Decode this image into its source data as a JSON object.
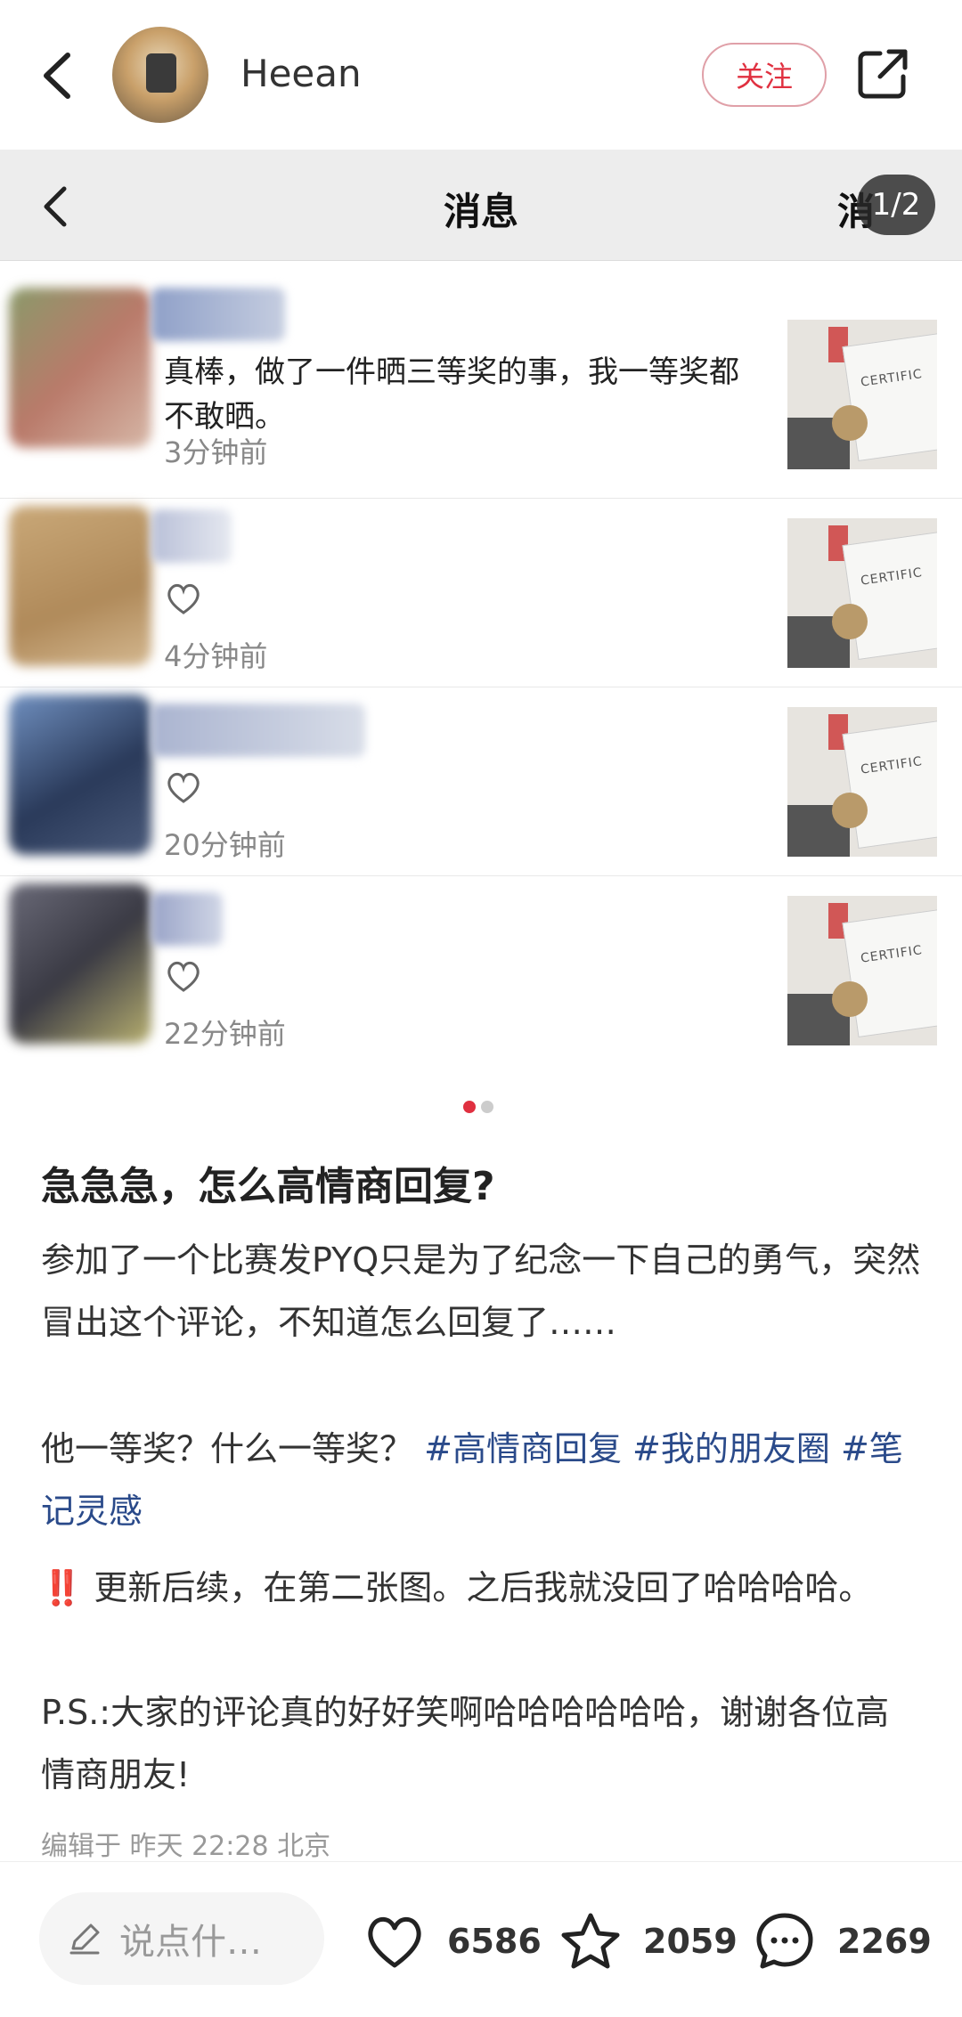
{
  "header": {
    "username": "Heean",
    "follow_label": "关注"
  },
  "image": {
    "page_indicator": "1/2",
    "msg_title": "消息",
    "msg_right_partial": "消",
    "rows": [
      {
        "text": "真棒，做了一件晒三等奖的事，我一等奖都不敢晒。",
        "time": "3分钟前"
      },
      {
        "text": "",
        "time": "4分钟前"
      },
      {
        "text": "",
        "time": "20分钟前"
      },
      {
        "text": "",
        "time": "22分钟前"
      }
    ],
    "thumb_text": "CERTIFIC"
  },
  "post": {
    "title": "急急急，怎么高情商回复?",
    "p1": "参加了一个比赛发PYQ只是为了纪念一下自己的勇气，突然冒出这个评论，不知道怎么回复了……",
    "p2_prefix": "他一等奖？什么一等奖？",
    "tags": [
      "#高情商回复",
      "#我的朋友圈",
      "#笔记灵感"
    ],
    "alert": "‼️",
    "p3": "更新后续，在第二张图。之后我就没回了哈哈哈哈。",
    "p4": "P.S.:大家的评论真的好好笑啊哈哈哈哈哈哈，谢谢各位高情商朋友!",
    "edit_info": "编辑于 昨天 22:28 北京"
  },
  "bottom": {
    "comment_placeholder": "说点什…",
    "likes": "6586",
    "favorites": "2059",
    "comments": "2269"
  },
  "colors": {
    "accent": "#e03040",
    "hashtag": "#2a4a8a",
    "dot_active": "#e03040",
    "dot_inactive": "#cccccc"
  }
}
